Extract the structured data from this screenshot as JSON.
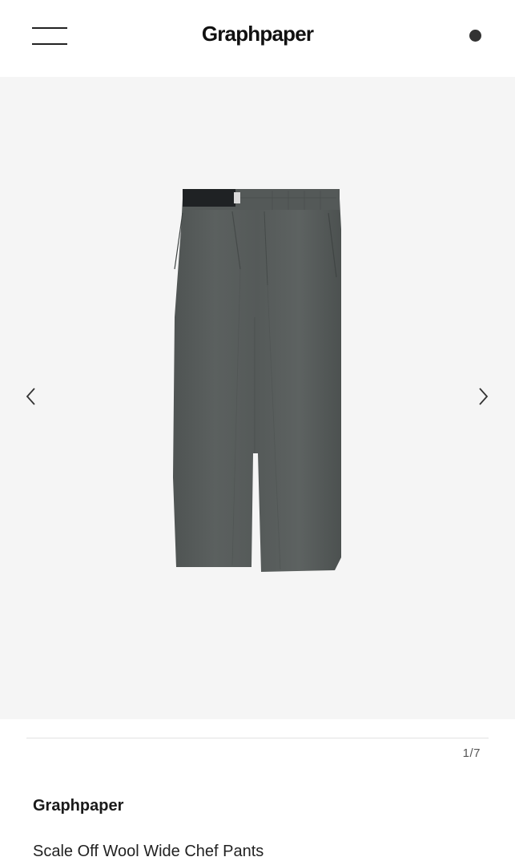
{
  "header": {
    "logo": "Graphpaper",
    "menu_icon": "hamburger-menu-icon",
    "cart_icon": "cart-dot-icon"
  },
  "gallery": {
    "prev_icon": "chevron-left-icon",
    "next_icon": "chevron-right-icon",
    "image_subject": "dark grey wide chef pants",
    "counter": "1/7",
    "colors": {
      "background": "#f5f5f5",
      "fabric": "#575c5b",
      "waistband_black": "#1f2224"
    }
  },
  "product": {
    "brand": "Graphpaper",
    "name": "Scale Off Wool Wide Chef Pants"
  }
}
